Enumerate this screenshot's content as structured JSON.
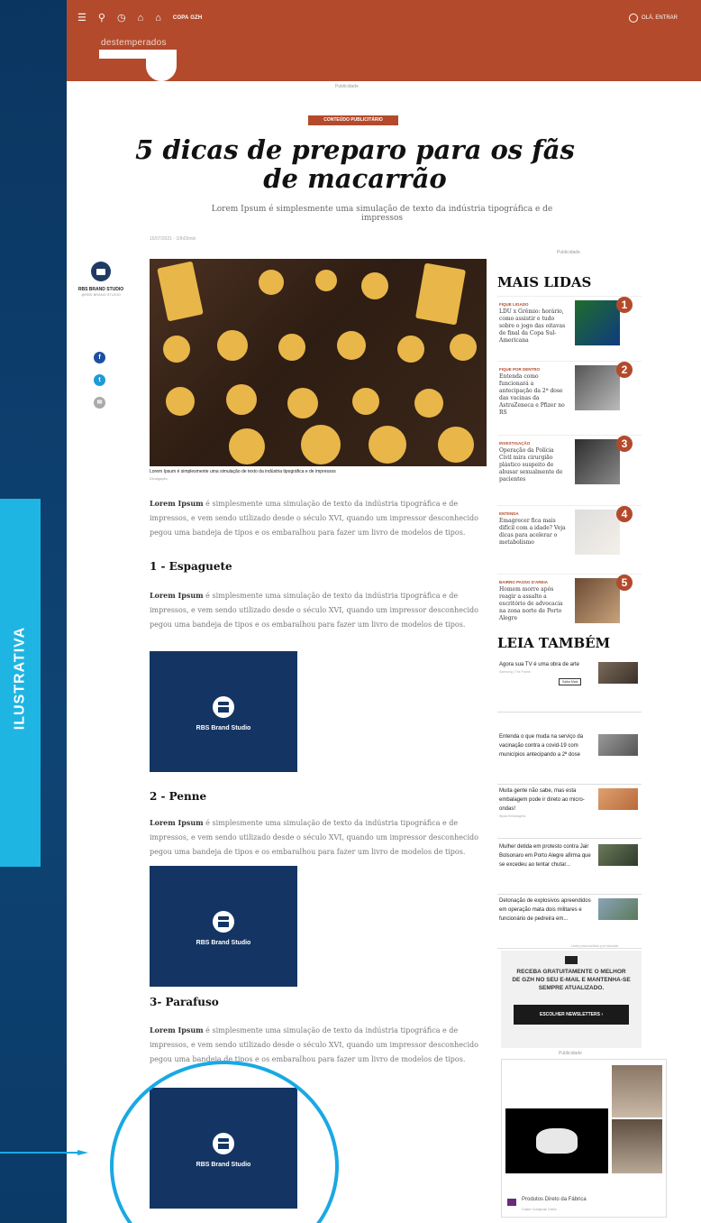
{
  "header": {
    "nav_label": "COPA GZH",
    "user_label": "OLÁ, ENTRAR",
    "logo_text": "destemperados",
    "colors": {
      "brand": "#b34a2c"
    }
  },
  "ad_top_label": "Publicidade",
  "article": {
    "badge": "CONTEÚDO PUBLICITÁRIO",
    "title": "5 dicas de preparo para os fãs de macarrão",
    "subtitle": "Lorem Ipsum é simplesmente uma simulação de texto da indústria tipográfica e de impressos",
    "date": "15/07/2021 - 10h02min",
    "author_name": "RBS BRAND STUDIO",
    "author_role": "@RBS BRAND STUDIO",
    "image_caption": "Lorem Ipsum é simplesmente uma simulação de texto da indústria tipográfica e de impressos",
    "image_credit": "Divulgação",
    "para_bold": "Lorem Ipsum",
    "para_rest": " é simplesmente uma simulação de texto da indústria tipográfica e de impressos, e vem sendo utilizado desde o século XVI, quando um impressor desconhecido pegou uma bandeja de tipos e os embaralhou para fazer um livro de modelos de tipos.",
    "sections": [
      "1 - Espaguete",
      "2 - Penne",
      "3- Parafuso"
    ],
    "video_label": "RBS Brand Studio"
  },
  "sidebar": {
    "ad_label": "Publicidade",
    "mais_lidas_title": "MAIS LIDAS",
    "mais_lidas": [
      {
        "num": "1",
        "cat": "FIQUE LIGADO",
        "text": "LDU x Grêmio: horário, como assistir e tudo sobre o jogo das oitavas de final da Copa Sul-Americana"
      },
      {
        "num": "2",
        "cat": "FIQUE POR DENTRO",
        "text": "Entenda como funcionará a antecipação da 2ª dose das vacinas da AstraZeneca e Pfizer no RS"
      },
      {
        "num": "3",
        "cat": "INVESTIGAÇÃO",
        "text": "Operação da Polícia Civil mira cirurgião plástico suspeito de abusar sexualmente de pacientes"
      },
      {
        "num": "4",
        "cat": "ENTENDA",
        "text": "Emagrecer fica mais difícil com a idade? Veja dicas para acelerar o metabolismo"
      },
      {
        "num": "5",
        "cat": "BAIRRO PASSO D'AREIA",
        "text": "Homem morre após reagir a assalto a escritório de advocacia na zona norte de Porto Alegre"
      }
    ],
    "leia_title": "LEIA TAMBÉM",
    "leia": [
      {
        "text": "Agora sua TV é uma obra de arte",
        "src": "Samsung | The Frame",
        "btn": "Saiba Mais"
      },
      {
        "text": "Entenda o que muda na serviço da vacinação contra a covid-19 com municípios antecipando a 2ª dose",
        "src": ""
      },
      {
        "text": "Muita gente não sabe, mas esta embalagem pode ir direto ao micro-ondas!",
        "src": "Wyda Embalagens"
      },
      {
        "text": "Mulher detida em protesto contra Jair Bolsonaro em Porto Alegre afirma que se excedeu ao tentar chutar...",
        "src": ""
      },
      {
        "text": "Detonação de explosivos apreendidos em operação mata dois militares e funcionário de pedreira em...",
        "src": ""
      }
    ],
    "promo_note": "Links promovidos por taboola",
    "newsletter_text": "RECEBA GRATUITAMENTE O MELHOR DE GZH NO SEU E-MAIL E MANTENHA-SE SEMPRE ATUALIZADO.",
    "newsletter_btn": "ESCOLHER NEWSLETTERS ›",
    "ad_bottom_label": "Publicidade",
    "ad_title": "Produtos Direto da Fábrica",
    "ad_sub": "Clube Compras Certo"
  },
  "overlay_label": "ILUSTRATIVA"
}
